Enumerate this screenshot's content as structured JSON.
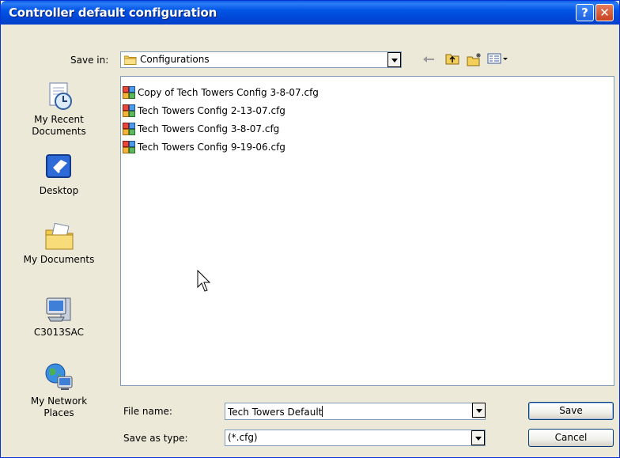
{
  "window": {
    "title": "Controller default configuration",
    "help_button": "?",
    "close_button": "✕"
  },
  "toolbar": {
    "save_in_label": "Save in:",
    "save_in_value": "Configurations",
    "icons": [
      "back-icon",
      "up-folder-icon",
      "new-folder-icon",
      "views-menu-icon"
    ]
  },
  "places": [
    {
      "label_lines": [
        "My Recent",
        "Documents"
      ],
      "icon": "recent-documents-icon"
    },
    {
      "label_lines": [
        "Desktop"
      ],
      "icon": "desktop-icon"
    },
    {
      "label_lines": [
        "My Documents"
      ],
      "icon": "my-documents-icon"
    },
    {
      "label_lines": [
        "C3013SAC"
      ],
      "icon": "my-computer-icon"
    },
    {
      "label_lines": [
        "My Network",
        "Places"
      ],
      "icon": "network-places-icon"
    }
  ],
  "files": [
    "Copy of Tech Towers Config 3-8-07.cfg",
    "Tech Towers Config 2-13-07.cfg",
    "Tech Towers Config 3-8-07.cfg",
    "Tech Towers Config 9-19-06.cfg"
  ],
  "form": {
    "file_name_label": "File name:",
    "file_name_value": "Tech Towers Default",
    "save_as_type_label": "Save as type:",
    "save_as_type_value": "(*.cfg)"
  },
  "buttons": {
    "save": "Save",
    "cancel": "Cancel"
  },
  "colors": {
    "titlebar": "#0054E3",
    "dialog_bg": "#ECE9D8",
    "input_border": "#7F9DB9"
  }
}
